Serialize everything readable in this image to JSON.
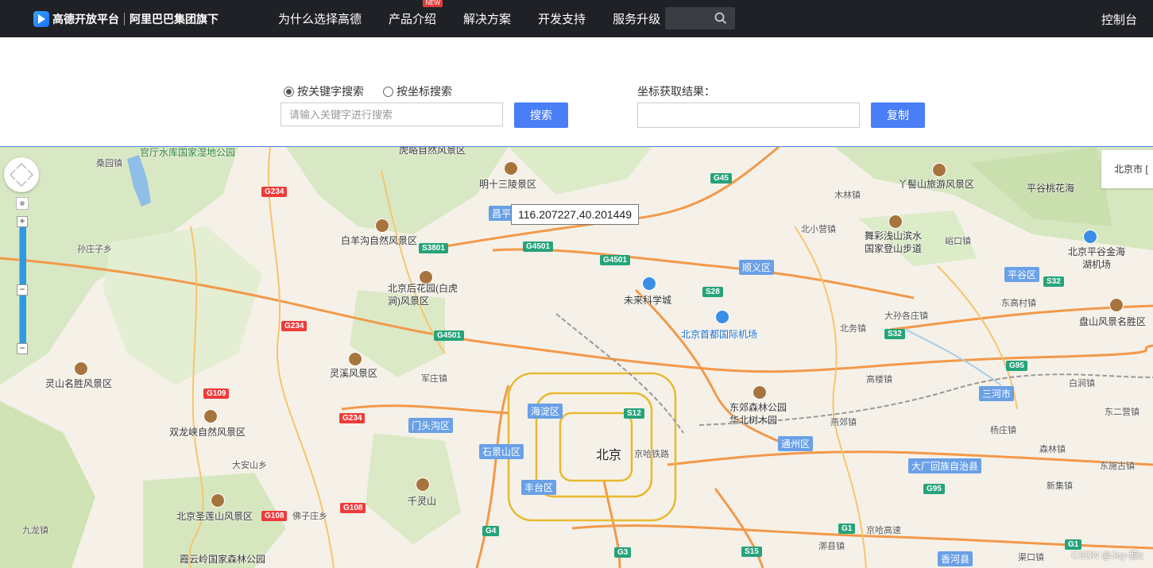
{
  "header": {
    "logo_text": "高德开放平台",
    "logo_sub": "阿里巴巴集团旗下",
    "nav": [
      {
        "label": "为什么选择高德"
      },
      {
        "label": "产品介绍",
        "badge": "NEW"
      },
      {
        "label": "解决方案"
      },
      {
        "label": "开发支持"
      },
      {
        "label": "服务升级"
      }
    ],
    "console": "控制台"
  },
  "form": {
    "radio_keyword": "按关键字搜索",
    "radio_coord": "按坐标搜索",
    "selected": "keyword",
    "keyword_placeholder": "请输入关键字进行搜索",
    "search_button": "搜索",
    "result_label": "坐标获取结果：",
    "result_value": "",
    "copy_button": "复制"
  },
  "map": {
    "coord_tip": "116.207227,40.201449",
    "city_box": "北京市 [",
    "center_city": "北京",
    "districts": [
      "昌平",
      "顺义区",
      "平谷区",
      "海淀区",
      "门头沟区",
      "石景山区",
      "丰台区",
      "通州区",
      "三河市",
      "大厂回族自治县",
      "香河县"
    ],
    "labels": [
      "官厅水库国家湿地公园",
      "桑园镇",
      "虎峪自然风景区",
      "明十三陵景区",
      "丫髻山旅游风景区",
      "平谷桃花海",
      "孙庄子乡",
      "白羊沟自然风景区",
      "北京后花园(白虎涧)风景区",
      "木林镇",
      "北小营镇",
      "舞彩浅山滨水国家登山步道",
      "峪口镇",
      "北京平谷金海湖机场",
      "未来科学城",
      "北京首都国际机场",
      "大孙各庄镇",
      "北务镇",
      "东高村镇",
      "盘山风景名胜区",
      "灵溪风景区",
      "灵山名胜风景区",
      "军庄镇",
      "高楼镇",
      "白涧镇",
      "东郊森林公园华北树木园",
      "双龙峡自然风景区",
      "大安山乡",
      "燕郊镇",
      "杨庄镇",
      "东二营镇",
      "森林镇",
      "新集镇",
      "东施古镇",
      "千灵山",
      "北京圣莲山风景区",
      "佛子庄乡",
      "九龙镇",
      "京哈铁路",
      "京哈高速",
      "漷县镇",
      "渠口镇",
      "霞云岭国家森林公园"
    ],
    "shields": [
      "G234",
      "G234",
      "G109",
      "G234",
      "G108",
      "G108",
      "G45",
      "S3801",
      "G4501",
      "G4501",
      "G4501",
      "S28",
      "S32",
      "S32",
      "G95",
      "G95",
      "S12",
      "G4",
      "G3",
      "S15",
      "G1",
      "G1"
    ],
    "watermark": "CSDN @Joy-鲸z"
  }
}
